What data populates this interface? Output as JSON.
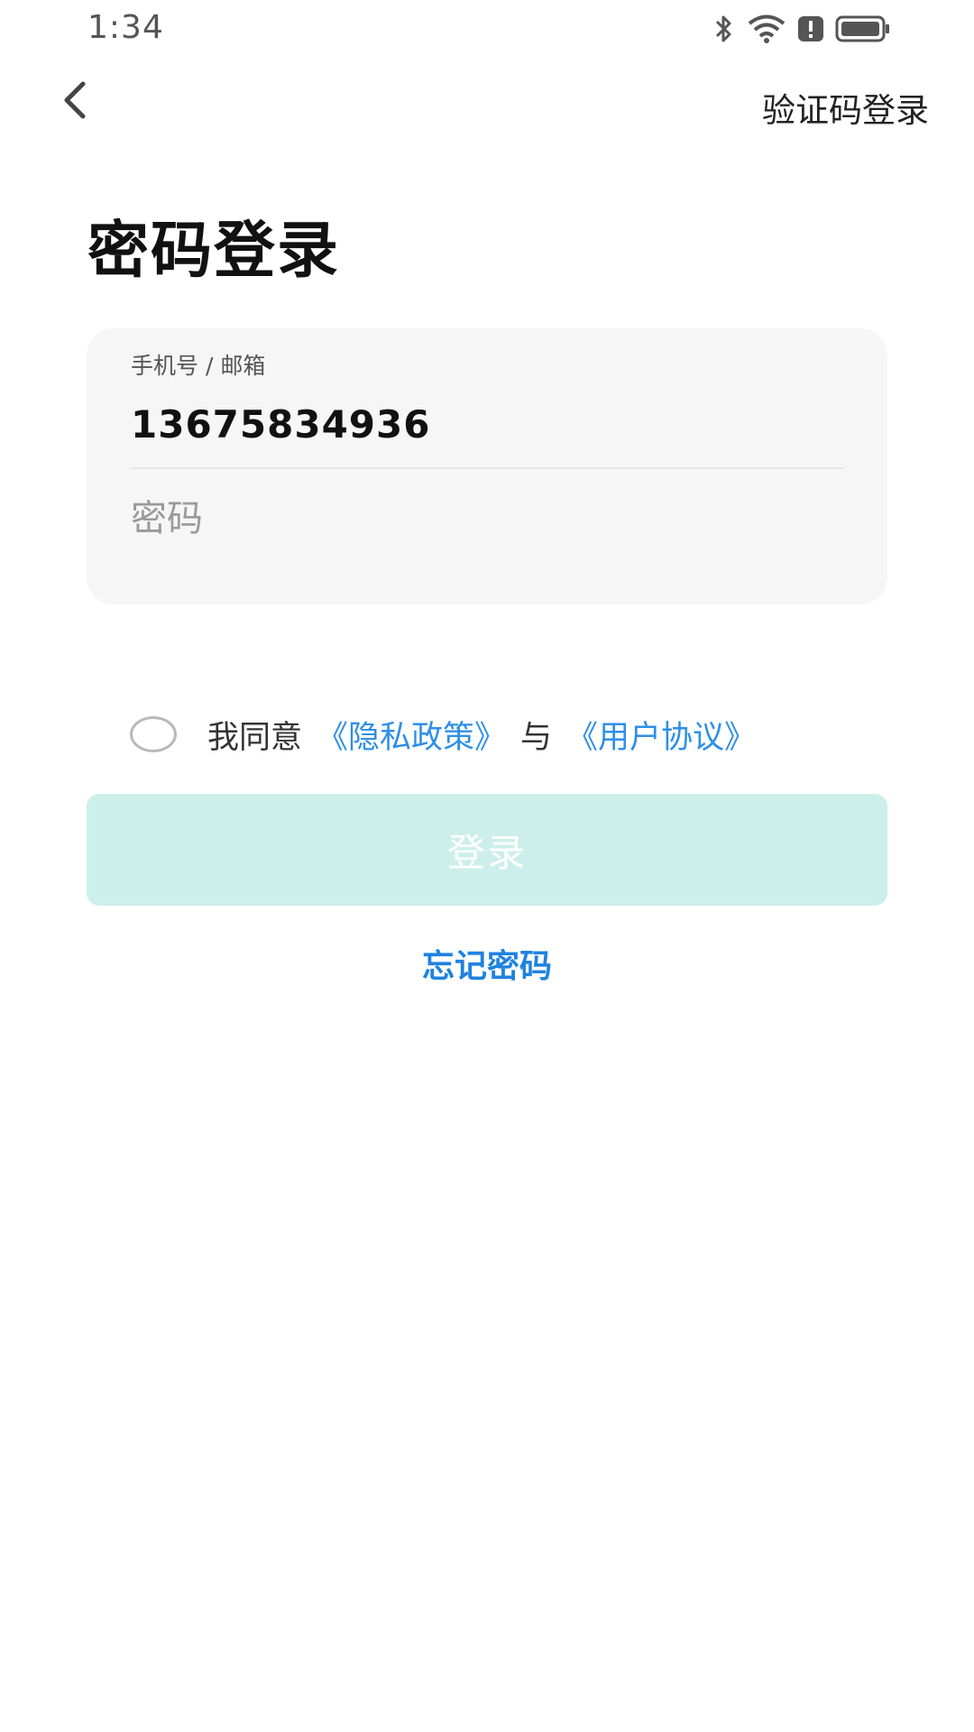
{
  "status_bar": {
    "time": "1:34"
  },
  "nav": {
    "back_icon": "chevron-left-icon",
    "switch_label": "验证码登录"
  },
  "page": {
    "title": "密码登录"
  },
  "form": {
    "account": {
      "label": "手机号 / 邮箱",
      "value": "13675834936"
    },
    "password": {
      "placeholder": "密码",
      "value": ""
    }
  },
  "agreement": {
    "checked": false,
    "prefix": "我同意",
    "privacy_link": "《隐私政策》",
    "separator": "与",
    "terms_link": "《用户协议》"
  },
  "actions": {
    "login_label": "登录",
    "forgot_label": "忘记密码"
  },
  "colors": {
    "link": "#2f8fe6",
    "login_disabled_bg": "#cdefeb",
    "card_bg": "#f6f6f6"
  }
}
